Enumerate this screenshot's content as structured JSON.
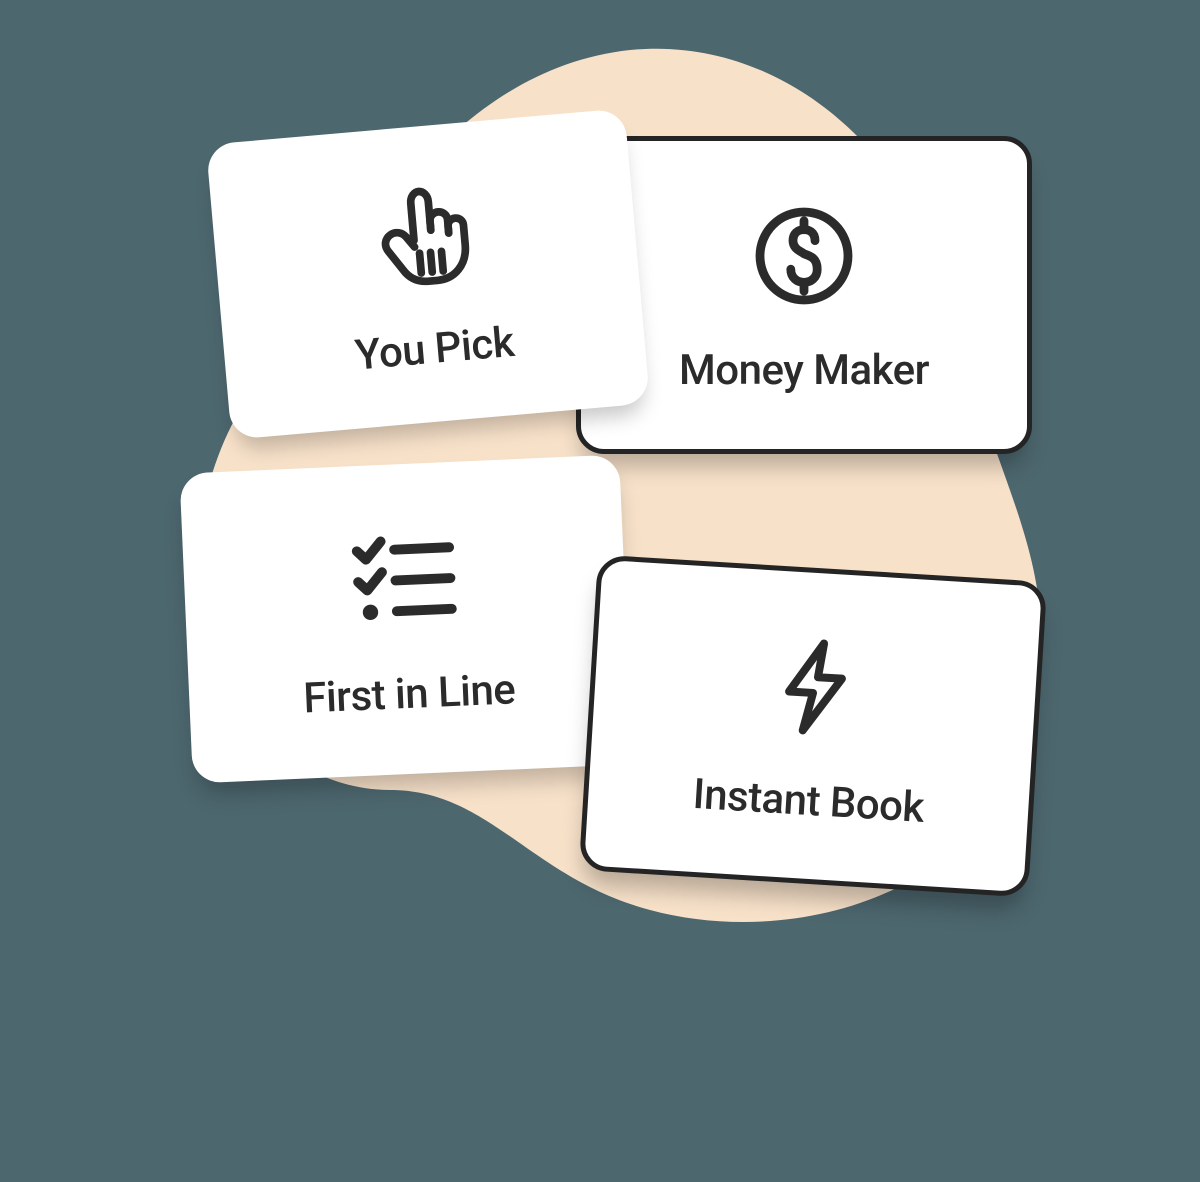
{
  "cards": {
    "you_pick": {
      "label": "You Pick",
      "icon": "pointer-hand-icon"
    },
    "money_maker": {
      "label": "Money Maker",
      "icon": "dollar-circle-icon"
    },
    "first_in_line": {
      "label": "First in Line",
      "icon": "checklist-icon"
    },
    "instant_book": {
      "label": "Instant Book",
      "icon": "lightning-icon"
    }
  },
  "colors": {
    "background": "#4d676f",
    "blob": "#f7e1c9",
    "card_bg": "#ffffff",
    "outline": "#242424",
    "text": "#2b2b2b"
  }
}
